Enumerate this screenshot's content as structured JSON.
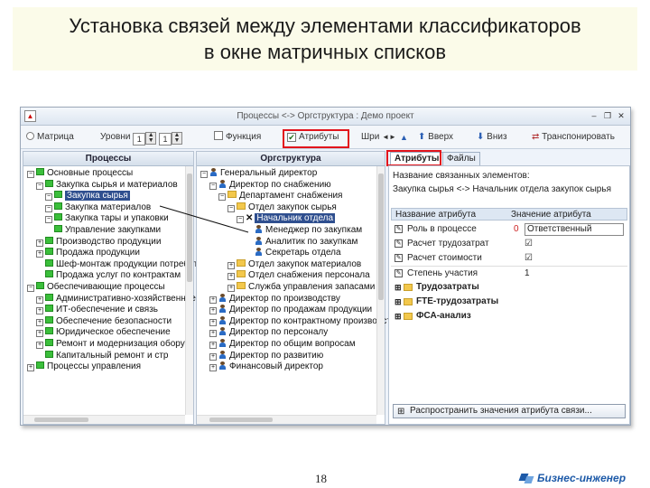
{
  "slide": {
    "title_line1": "Установка связей между элементами классификаторов",
    "title_line2": "в окне матричных списков",
    "page_number": "18",
    "brand": "Бизнес-инженер"
  },
  "window": {
    "title": "Процессы <-> Оргструктура : Демо проект",
    "min": "–",
    "restore": "❐",
    "close": "✕"
  },
  "toolbar": {
    "matrix_label": "Матрица",
    "level1_label": "Уровни",
    "level1_value": "1",
    "level2_value": "1",
    "function_label": "Функция",
    "attributes_label": "Атрибуты",
    "width_label": "Шри",
    "up_label": "Вверх",
    "down_label": "Вниз",
    "transpose_label": "Транспонировать"
  },
  "left_pane": {
    "header": "Процессы",
    "rows": [
      "Основные процессы",
      "Закупка сырья и материалов",
      "Закупка сырья",
      "Закупка материалов",
      "Закупка тары и упаковки",
      "Управление закупками",
      "Производство продукции",
      "Продажа продукции",
      "Шеф-монтаж продукции потребителям",
      "Продажа услуг по контрактам",
      "Обеспечивающие процессы",
      "Административно-хозяйственное",
      "ИТ-обеспечение и связь",
      "Обеспечение безопасности",
      "Юридическое обеспечение",
      "Ремонт и модернизация обору",
      "Капитальный ремонт и стр",
      "Процессы управления"
    ]
  },
  "middle_pane": {
    "header": "Оргструктура",
    "rows": [
      "Генеральный директор",
      "Директор по снабжению",
      "Департамент снабжения",
      "Отдел закупок сырья",
      "Начальник отдела",
      "Менеджер по закупкам",
      "Аналитик по закупкам",
      "Секретарь отдела",
      "Отдел закупок материалов",
      "Отдел снабжения персонала",
      "Служба управления запасами",
      "Директор по производству",
      "Директор по продажам продукции",
      "Директор по контрактному производству",
      "Директор по персоналу",
      "Директор по общим вопросам",
      "Директор по развитию",
      "Финансовый директор"
    ]
  },
  "right_panel": {
    "tab_attributes": "Атрибуты",
    "tab_file": "Файлы",
    "linked_title": "Название связанных элементов:",
    "linked_value": "Закупка сырья <-> Начальник отдела закупок сырья",
    "col_name": "Название атрибута",
    "col_value": "Значение атрибута",
    "rows": [
      {
        "name": "Роль в процессе",
        "value": "Ответственный"
      },
      {
        "name": "Расчет трудозатрат",
        "value": "☑"
      },
      {
        "name": "Расчет стоимости",
        "value": "☑"
      },
      {
        "name": "Степень участия",
        "value": "1"
      },
      {
        "name": "Трудозатраты",
        "value": ""
      },
      {
        "name": "FTE-трудозатраты",
        "value": ""
      },
      {
        "name": "ФСА-анализ",
        "value": ""
      }
    ],
    "bottom_button": "Распространить значения атрибута связи..."
  }
}
